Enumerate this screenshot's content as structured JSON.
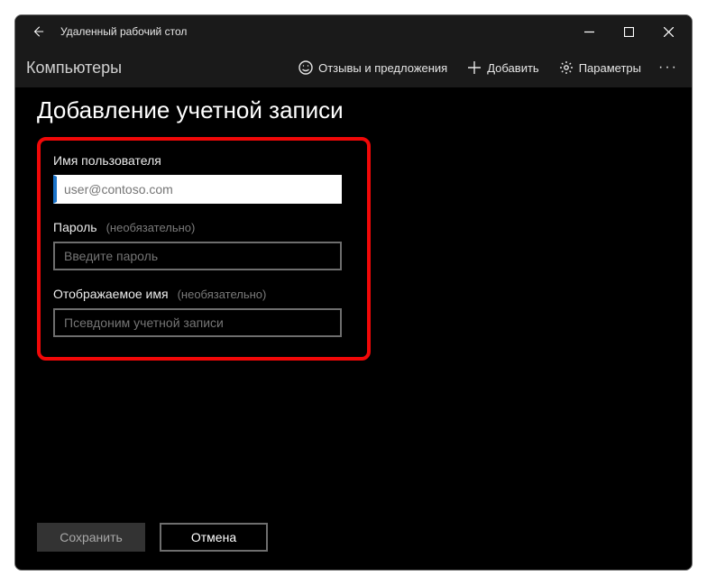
{
  "titlebar": {
    "app_title": "Удаленный рабочий стол"
  },
  "cmdbar": {
    "left_label": "Компьютеры",
    "feedback_label": "Отзывы и предложения",
    "add_label": "Добавить",
    "settings_label": "Параметры"
  },
  "content": {
    "page_title": "Добавление учетной записи",
    "username": {
      "label": "Имя пользователя",
      "placeholder": "user@contoso.com",
      "value": ""
    },
    "password": {
      "label": "Пароль",
      "optional": "(необязательно)",
      "placeholder": "Введите пароль",
      "value": ""
    },
    "displayname": {
      "label": "Отображаемое имя",
      "optional": "(необязательно)",
      "placeholder": "Псевдоним учетной записи",
      "value": ""
    }
  },
  "footer": {
    "save_label": "Сохранить",
    "cancel_label": "Отмена"
  },
  "colors": {
    "highlight_border": "#f10808",
    "accent": "#1a73c9"
  }
}
